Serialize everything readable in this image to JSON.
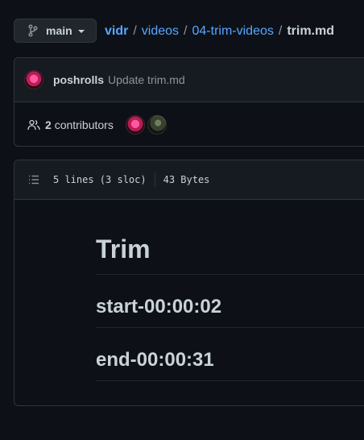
{
  "branch": {
    "name": "main",
    "icon": "git-branch-icon"
  },
  "breadcrumb": {
    "repo": "vidr",
    "folder1": "videos",
    "folder2": "04-trim-videos",
    "file": "trim.md",
    "separator": "/"
  },
  "latest_commit": {
    "author": "poshrolls",
    "message": "Update trim.md"
  },
  "contributors": {
    "count": "2",
    "label": "contributors"
  },
  "file_info": {
    "lines": "5 lines (3 sloc)",
    "size": "43 Bytes"
  },
  "markdown": {
    "h1": "Trim",
    "h2_start": "start-00:00:02",
    "h2_end": "end-00:00:31"
  },
  "colors": {
    "link": "#58a6ff",
    "bg": "#0d1117",
    "panel": "#161b22",
    "border": "#30363d",
    "text": "#c9d1d9",
    "muted": "#8b949e"
  }
}
